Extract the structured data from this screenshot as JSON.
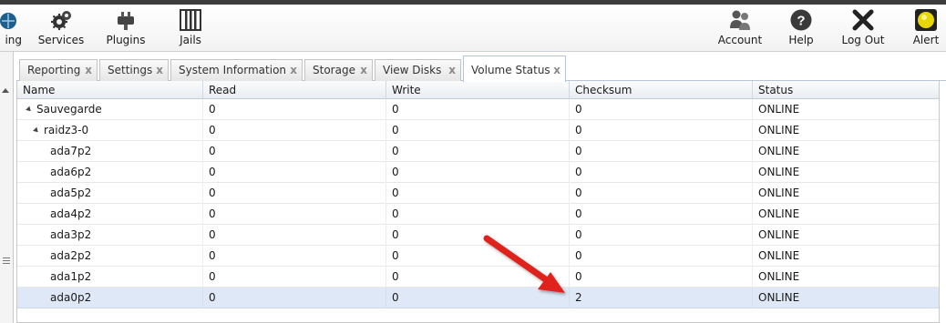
{
  "toolbar": {
    "items": [
      {
        "label": "ing",
        "icon": "network-icon"
      },
      {
        "label": "Services",
        "icon": "gears-icon"
      },
      {
        "label": "Plugins",
        "icon": "plug-icon"
      },
      {
        "label": "Jails",
        "icon": "jail-icon"
      },
      {
        "label": "Account",
        "icon": "users-icon"
      },
      {
        "label": "Help",
        "icon": "help-icon"
      },
      {
        "label": "Log Out",
        "icon": "logout-icon"
      },
      {
        "label": "Alert",
        "icon": "alert-icon"
      }
    ]
  },
  "tabs": [
    {
      "label": "Reporting",
      "active": false
    },
    {
      "label": "Settings",
      "active": false
    },
    {
      "label": "System Information",
      "active": false
    },
    {
      "label": "Storage",
      "active": false
    },
    {
      "label": "View Disks",
      "active": false
    },
    {
      "label": "Volume Status",
      "active": true
    }
  ],
  "tab_close_glyph": "x",
  "grid": {
    "columns": [
      "Name",
      "Read",
      "Write",
      "Checksum",
      "Status"
    ],
    "rows": [
      {
        "name": "Sauvegarde",
        "read": "0",
        "write": "0",
        "checksum": "0",
        "status": "ONLINE",
        "level": 0,
        "expander": true,
        "selected": false
      },
      {
        "name": "raidz3-0",
        "read": "0",
        "write": "0",
        "checksum": "0",
        "status": "ONLINE",
        "level": 1,
        "expander": true,
        "selected": false
      },
      {
        "name": "ada7p2",
        "read": "0",
        "write": "0",
        "checksum": "0",
        "status": "ONLINE",
        "level": 2,
        "expander": false,
        "selected": false
      },
      {
        "name": "ada6p2",
        "read": "0",
        "write": "0",
        "checksum": "0",
        "status": "ONLINE",
        "level": 2,
        "expander": false,
        "selected": false
      },
      {
        "name": "ada5p2",
        "read": "0",
        "write": "0",
        "checksum": "0",
        "status": "ONLINE",
        "level": 2,
        "expander": false,
        "selected": false
      },
      {
        "name": "ada4p2",
        "read": "0",
        "write": "0",
        "checksum": "0",
        "status": "ONLINE",
        "level": 2,
        "expander": false,
        "selected": false
      },
      {
        "name": "ada3p2",
        "read": "0",
        "write": "0",
        "checksum": "0",
        "status": "ONLINE",
        "level": 2,
        "expander": false,
        "selected": false
      },
      {
        "name": "ada2p2",
        "read": "0",
        "write": "0",
        "checksum": "0",
        "status": "ONLINE",
        "level": 2,
        "expander": false,
        "selected": false
      },
      {
        "name": "ada1p2",
        "read": "0",
        "write": "0",
        "checksum": "0",
        "status": "ONLINE",
        "level": 2,
        "expander": false,
        "selected": false
      },
      {
        "name": "ada0p2",
        "read": "0",
        "write": "0",
        "checksum": "2",
        "status": "ONLINE",
        "level": 2,
        "expander": false,
        "selected": true
      }
    ]
  },
  "colors": {
    "selected_row": "#dfe8f6",
    "annotation_arrow": "#e0201b",
    "alert_yellow": "#e8d800"
  }
}
